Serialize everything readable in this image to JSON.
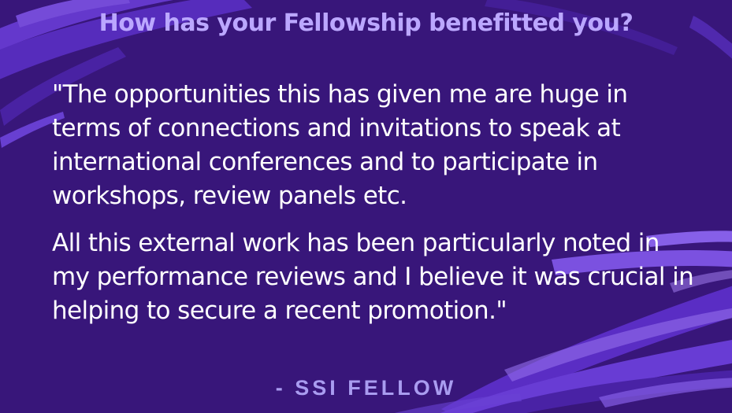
{
  "heading": "How has your Fellowship benefitted you?",
  "quote": {
    "paragraph_1": "\"The opportunities this has given me are huge in terms of connections and invitations to speak at international conferences and to participate in workshops, review panels etc.",
    "paragraph_2": "All this external work has been particularly noted in my performance reviews and I believe it was crucial in helping to secure a recent promotion.\""
  },
  "attribution": "- SSI FELLOW",
  "colors": {
    "background": "#38167a",
    "heading": "#bba7ff",
    "quote_text": "#ffffff",
    "attribution": "#a99cf0",
    "brush_strokes": [
      "#5a2fc6",
      "#6b3fd9",
      "#7f55e6",
      "#4a23a8"
    ]
  }
}
